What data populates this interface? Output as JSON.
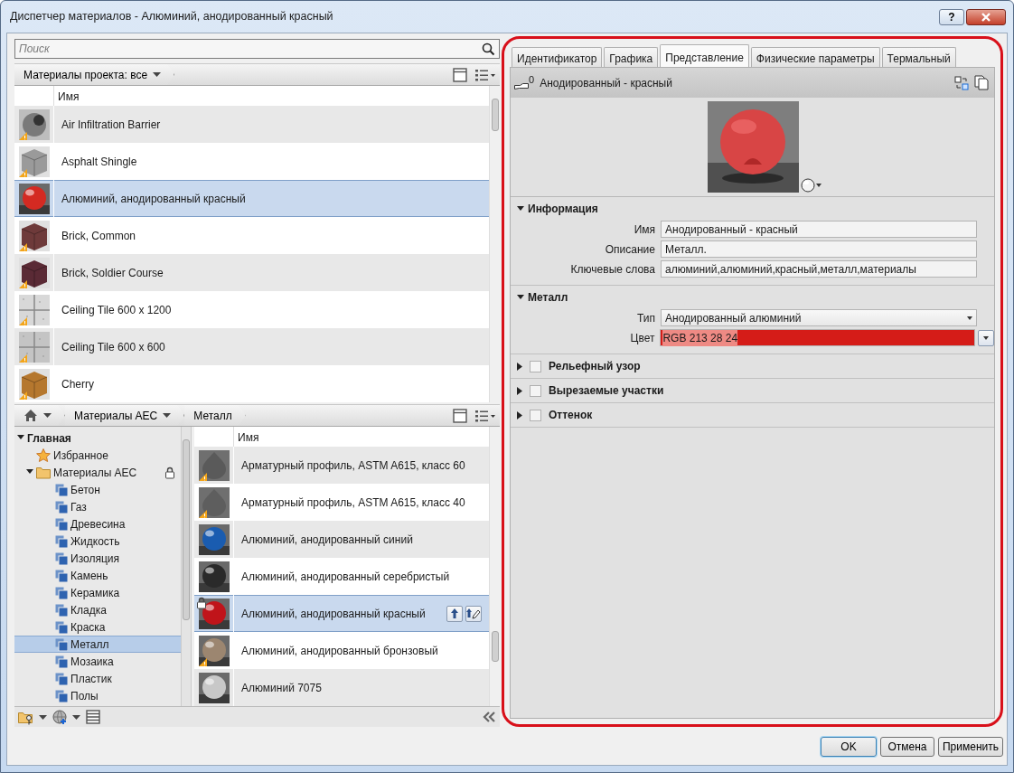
{
  "window": {
    "title": "Диспетчер материалов - Алюминий, анодированный красный",
    "help": "?"
  },
  "search": {
    "placeholder": "Поиск"
  },
  "project_materials": {
    "filter": "Материалы проекта: все",
    "column": "Имя",
    "rows": [
      {
        "name": "Air Infiltration Barrier",
        "swatch": {
          "kind": "roll",
          "color": "#7a7a7a"
        },
        "warning": true,
        "selected": false
      },
      {
        "name": "Asphalt Shingle",
        "swatch": {
          "kind": "cube",
          "color": "#9a9a9a"
        },
        "warning": true,
        "selected": false
      },
      {
        "name": "Алюминий, анодированный красный",
        "swatch": {
          "kind": "sphere",
          "color": "#d42a22"
        },
        "warning": false,
        "selected": true
      },
      {
        "name": "Brick, Common",
        "swatch": {
          "kind": "cube",
          "color": "#6e3a3a"
        },
        "warning": true,
        "selected": false
      },
      {
        "name": "Brick, Soldier Course",
        "swatch": {
          "kind": "cube",
          "color": "#5a2a35"
        },
        "warning": true,
        "selected": false
      },
      {
        "name": "Ceiling Tile 600 x 1200",
        "swatch": {
          "kind": "tiles",
          "color": "#d8d8d8"
        },
        "warning": true,
        "selected": false
      },
      {
        "name": "Ceiling Tile 600 x 600",
        "swatch": {
          "kind": "tiles",
          "color": "#c4c4c4"
        },
        "warning": true,
        "selected": false
      },
      {
        "name": "Cherry",
        "swatch": {
          "kind": "cube",
          "color": "#b5772e"
        },
        "warning": true,
        "selected": false
      }
    ]
  },
  "library": {
    "breadcrumb": [
      "Материалы AEC",
      "Металл"
    ],
    "tree": [
      {
        "label": "Главная",
        "kind": "root",
        "expanded": true,
        "locked": false,
        "selected": false,
        "children": [
          {
            "label": "Избранное",
            "kind": "favorites",
            "locked": false,
            "selected": false
          },
          {
            "label": "Материалы AEC",
            "kind": "folder",
            "expanded": true,
            "locked": true,
            "selected": false,
            "children": [
              {
                "label": "Бетон",
                "kind": "category",
                "selected": false
              },
              {
                "label": "Газ",
                "kind": "category",
                "selected": false
              },
              {
                "label": "Древесина",
                "kind": "category",
                "selected": false
              },
              {
                "label": "Жидкость",
                "kind": "category",
                "selected": false
              },
              {
                "label": "Изоляция",
                "kind": "category",
                "selected": false
              },
              {
                "label": "Камень",
                "kind": "category",
                "selected": false
              },
              {
                "label": "Керамика",
                "kind": "category",
                "selected": false
              },
              {
                "label": "Кладка",
                "kind": "category",
                "selected": false
              },
              {
                "label": "Краска",
                "kind": "category",
                "selected": false
              },
              {
                "label": "Металл",
                "kind": "category",
                "selected": true
              },
              {
                "label": "Мозаика",
                "kind": "category",
                "selected": false
              },
              {
                "label": "Пластик",
                "kind": "category",
                "selected": false
              },
              {
                "label": "Полы",
                "kind": "category",
                "selected": false
              }
            ]
          }
        ]
      }
    ],
    "column": "Имя",
    "rows": [
      {
        "name": "Арматурный профиль, ASTM A615, класс 60",
        "swatch": {
          "kind": "cone",
          "color": "#5a5a5a"
        },
        "warning": true,
        "locked": false,
        "selected": false
      },
      {
        "name": "Арматурный профиль, ASTM A615, класс 40",
        "swatch": {
          "kind": "cone",
          "color": "#5e5e5e"
        },
        "warning": true,
        "locked": false,
        "selected": false
      },
      {
        "name": "Алюминий, анодированный синий",
        "swatch": {
          "kind": "sphere",
          "color": "#1a5cb0"
        },
        "warning": false,
        "locked": false,
        "selected": false
      },
      {
        "name": "Алюминий, анодированный серебристый",
        "swatch": {
          "kind": "sphere",
          "color": "#2a2a2a"
        },
        "warning": false,
        "locked": false,
        "selected": false
      },
      {
        "name": "Алюминий, анодированный красный",
        "swatch": {
          "kind": "sphere",
          "color": "#c0141a"
        },
        "warning": false,
        "locked": true,
        "selected": true
      },
      {
        "name": "Алюминий, анодированный бронзовый",
        "swatch": {
          "kind": "sphere",
          "color": "#9c8670"
        },
        "warning": true,
        "locked": false,
        "selected": false
      },
      {
        "name": "Алюминий 7075",
        "swatch": {
          "kind": "sphere",
          "color": "#c8c8c8"
        },
        "warning": false,
        "locked": false,
        "selected": false
      }
    ]
  },
  "editor": {
    "tabs": [
      {
        "label": "Идентификатор",
        "selected": false
      },
      {
        "label": "Графика",
        "selected": false
      },
      {
        "label": "Представление",
        "selected": true
      },
      {
        "label": "Физические параметры",
        "selected": false
      },
      {
        "label": "Термальный",
        "selected": false
      }
    ],
    "asset": {
      "count": "0",
      "name": "Анодированный - красный"
    },
    "sections": [
      {
        "title": "Информация",
        "kind": "plain",
        "expanded": true,
        "fields": [
          {
            "label": "Имя",
            "kind": "text",
            "value": "Анодированный - красный"
          },
          {
            "label": "Описание",
            "kind": "text",
            "value": "Металл."
          },
          {
            "label": "Ключевые слова",
            "kind": "text",
            "value": "алюминий,алюминий,красный,металл,материалы"
          }
        ]
      },
      {
        "title": "Металл",
        "kind": "plain",
        "expanded": true,
        "fields": [
          {
            "label": "Тип",
            "kind": "select",
            "value": "Анодированный алюминий"
          },
          {
            "label": "Цвет",
            "kind": "color",
            "value": "RGB 213 28 24",
            "color": "#d51c18"
          }
        ]
      },
      {
        "title": "Рельефный узор",
        "kind": "checkbox",
        "expanded": false,
        "checked": false
      },
      {
        "title": "Вырезаемые участки",
        "kind": "checkbox",
        "expanded": false,
        "checked": false
      },
      {
        "title": "Оттенок",
        "kind": "checkbox",
        "expanded": false,
        "checked": false
      }
    ]
  },
  "buttons": [
    {
      "label": "OK",
      "default": true
    },
    {
      "label": "Отмена",
      "default": false
    },
    {
      "label": "Применить",
      "default": false
    }
  ]
}
